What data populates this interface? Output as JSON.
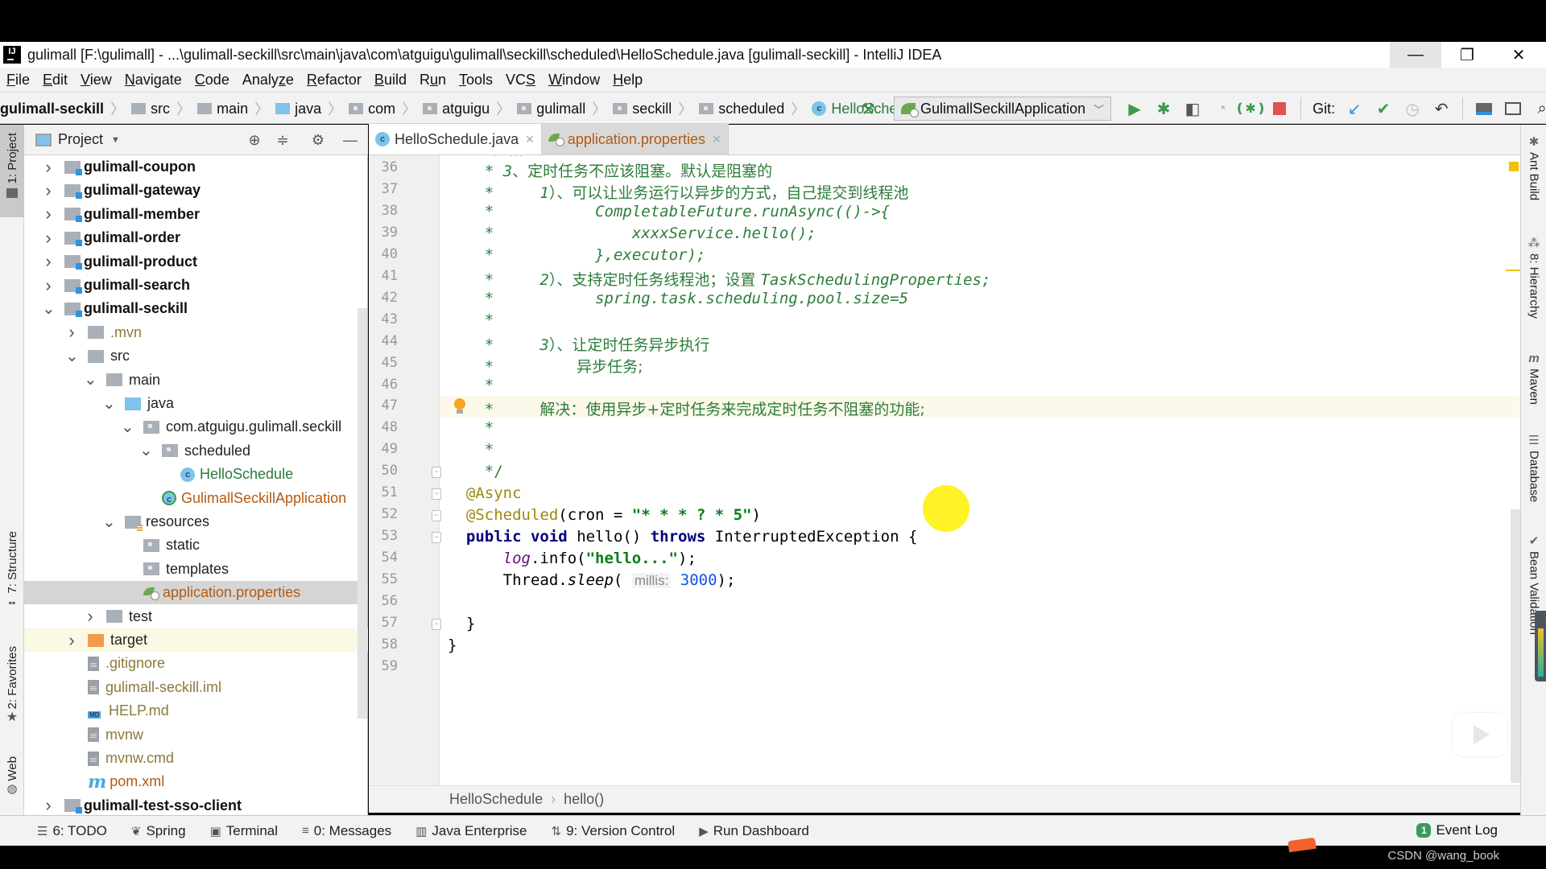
{
  "window": {
    "title": "gulimall [F:\\gulimall] - ...\\gulimall-seckill\\src\\main\\java\\com\\atguigu\\gulimall\\seckill\\scheduled\\HelloSchedule.java [gulimall-seckill] - IntelliJ IDEA",
    "logo": "IJ",
    "minimize": "—",
    "restore": "❐",
    "close": "✕"
  },
  "menu": [
    {
      "u": "F",
      "rest": "ile"
    },
    {
      "u": "E",
      "rest": "dit"
    },
    {
      "u": "V",
      "rest": "iew"
    },
    {
      "u": "N",
      "rest": "avigate"
    },
    {
      "u": "C",
      "rest": "ode"
    },
    {
      "pre": "Analy",
      "u": "z",
      "rest": "e"
    },
    {
      "u": "R",
      "rest": "efactor"
    },
    {
      "u": "B",
      "rest": "uild"
    },
    {
      "pre": "R",
      "u": "u",
      "rest": "n"
    },
    {
      "u": "T",
      "rest": "ools"
    },
    {
      "pre": "VC",
      "u": "S",
      "rest": ""
    },
    {
      "u": "W",
      "rest": "indow"
    },
    {
      "u": "H",
      "rest": "elp"
    }
  ],
  "navbar": {
    "crumbs": [
      "gulimall-seckill",
      "src",
      "main",
      "java",
      "com",
      "atguigu",
      "gulimall",
      "seckill",
      "scheduled",
      "HelloSchedule"
    ],
    "run_config": "GulimallSeckillApplication",
    "git_label": "Git:",
    "icons": {
      "build": "hammer-icon",
      "run": "run-icon",
      "debug": "debug-icon",
      "coverage": "coverage-icon",
      "profile": "profile-icon",
      "attach_debugger": "attach-debugger-icon",
      "stop": "stop-icon",
      "git_update": "git-update-icon",
      "git_commit": "git-commit-icon",
      "git_history": "git-history-icon",
      "git_rollback": "git-rollback-icon",
      "project_structure": "project-structure-icon",
      "run_anything": "run-anything-icon",
      "search": "search-icon"
    }
  },
  "left_strip": {
    "project": "1: Project",
    "structure": "7: Structure",
    "favorites": "2: Favorites",
    "web": "Web"
  },
  "project_panel": {
    "title": "Project",
    "tree": [
      {
        "label": "gulimall-coupon",
        "level": 0,
        "arrow": "collapsed",
        "icon": "module",
        "style": "bold"
      },
      {
        "label": "gulimall-gateway",
        "level": 0,
        "arrow": "collapsed",
        "icon": "module",
        "style": "bold"
      },
      {
        "label": "gulimall-member",
        "level": 0,
        "arrow": "collapsed",
        "icon": "module",
        "style": "bold"
      },
      {
        "label": "gulimall-order",
        "level": 0,
        "arrow": "collapsed",
        "icon": "module",
        "style": "bold"
      },
      {
        "label": "gulimall-product",
        "level": 0,
        "arrow": "collapsed",
        "icon": "module",
        "style": "bold"
      },
      {
        "label": "gulimall-search",
        "level": 0,
        "arrow": "collapsed",
        "icon": "module",
        "style": "bold"
      },
      {
        "label": "gulimall-seckill",
        "level": 0,
        "arrow": "expanded",
        "icon": "module",
        "style": "bold"
      },
      {
        "label": ".mvn",
        "level": 1,
        "arrow": "collapsed",
        "icon": "folder",
        "style": "olive"
      },
      {
        "label": "src",
        "level": 1,
        "arrow": "expanded",
        "icon": "folder",
        "style": "dark"
      },
      {
        "label": "main",
        "level": 2,
        "arrow": "expanded",
        "icon": "folder",
        "style": "dark"
      },
      {
        "label": "java",
        "level": 3,
        "arrow": "expanded",
        "icon": "source-folder",
        "style": "dark"
      },
      {
        "label": "com.atguigu.gulimall.seckill",
        "level": 4,
        "arrow": "expanded",
        "icon": "package",
        "style": "dark"
      },
      {
        "label": "scheduled",
        "level": 5,
        "arrow": "expanded",
        "icon": "package",
        "style": "dark"
      },
      {
        "label": "HelloSchedule",
        "level": 6,
        "arrow": "none",
        "icon": "class",
        "style": "green"
      },
      {
        "label": "GulimallSeckillApplication",
        "level": 5,
        "arrow": "none",
        "icon": "spring-boot-class",
        "style": "orange"
      },
      {
        "label": "resources",
        "level": 3,
        "arrow": "expanded",
        "icon": "resources-folder",
        "style": "dark"
      },
      {
        "label": "static",
        "level": 4,
        "arrow": "none",
        "icon": "package",
        "style": "dark"
      },
      {
        "label": "templates",
        "level": 4,
        "arrow": "none",
        "icon": "package",
        "style": "dark"
      },
      {
        "label": "application.properties",
        "level": 4,
        "arrow": "none",
        "icon": "spring-properties",
        "style": "orange",
        "selected": true
      },
      {
        "label": "test",
        "level": 2,
        "arrow": "collapsed",
        "icon": "folder",
        "style": "dark"
      },
      {
        "label": "target",
        "level": 1,
        "arrow": "collapsed",
        "icon": "excluded-folder",
        "style": "dark",
        "excluded": true
      },
      {
        "label": ".gitignore",
        "level": 1,
        "arrow": "none",
        "icon": "text-file",
        "style": "olive"
      },
      {
        "label": "gulimall-seckill.iml",
        "level": 1,
        "arrow": "none",
        "icon": "iml-file",
        "style": "olive"
      },
      {
        "label": "HELP.md",
        "level": 1,
        "arrow": "none",
        "icon": "markdown-file",
        "style": "olive"
      },
      {
        "label": "mvnw",
        "level": 1,
        "arrow": "none",
        "icon": "text-file",
        "style": "olive"
      },
      {
        "label": "mvnw.cmd",
        "level": 1,
        "arrow": "none",
        "icon": "text-file",
        "style": "olive"
      },
      {
        "label": "pom.xml",
        "level": 1,
        "arrow": "none",
        "icon": "maven-file",
        "style": "orange"
      },
      {
        "label": "gulimall-test-sso-client",
        "level": 0,
        "arrow": "collapsed",
        "icon": "module",
        "style": "bold"
      }
    ]
  },
  "editor": {
    "tabs": [
      {
        "label": "HelloSchedule.java",
        "active": true,
        "icon": "class-icon"
      },
      {
        "label": "application.properties",
        "active": false,
        "icon": "spring-properties-icon"
      }
    ],
    "lines": [
      {
        "n": 36,
        "text": "         * 3、定时任务不应该阻塞。默认是阻塞的"
      },
      {
        "n": 37,
        "text": "         *      1）、可以让业务运行以异步的方式，自己提交到线程池"
      },
      {
        "n": 38,
        "text": "         *              CompletableFuture.runAsync(()->{"
      },
      {
        "n": 39,
        "text": "         *                  xxxxService.hello();"
      },
      {
        "n": 40,
        "text": "         *              },executor);"
      },
      {
        "n": 41,
        "text": "         *      2）、支持定时任务线程池；设置 TaskSchedulingProperties;"
      },
      {
        "n": 42,
        "text": "         *              spring.task.scheduling.pool.size=5"
      },
      {
        "n": 43,
        "text": "         *"
      },
      {
        "n": 44,
        "text": "         *      3）、让定时任务异步执行"
      },
      {
        "n": 45,
        "text": "         *          异步任务;"
      },
      {
        "n": 46,
        "text": "         *"
      },
      {
        "n": 47,
        "text": "         *     解决：使用异步+定时任务来完成定时任务不阻塞的功能;"
      },
      {
        "n": 48,
        "text": "         *"
      },
      {
        "n": 49,
        "text": "         *"
      },
      {
        "n": 50,
        "text": "         */"
      },
      {
        "n": 51,
        "text": "    @Async"
      },
      {
        "n": 52,
        "text": "    @Scheduled(cron = \"* * * ? * 5\")"
      },
      {
        "n": 53,
        "text": "    public void hello() throws InterruptedException {"
      },
      {
        "n": 54,
        "text": "        log.info(\"hello...\");"
      },
      {
        "n": 55,
        "text": "        Thread.sleep( millis: 3000);"
      },
      {
        "n": 56,
        "text": ""
      },
      {
        "n": 57,
        "text": "    }"
      },
      {
        "n": 58,
        "text": "}"
      },
      {
        "n": 59,
        "text": ""
      }
    ],
    "current_line": 47,
    "parts": {
      "l36_star": "* ",
      "l36_num": "3",
      "l36_cn": "、定时任务不应该阻塞。默认是阻塞的",
      "star": "*",
      "l37_num": "1",
      "l37_cn": "）、可以让业务运行以异步的方式，自己提交到线程池",
      "l38_code": "CompletableFuture.runAsync(()->{",
      "l39_code": "xxxxService.hello();",
      "l40_code": "},executor);",
      "l41_num": "2",
      "l41_cn": "）、支持定时任务线程池；设置 ",
      "l41_code": "TaskSchedulingProperties;",
      "l42_code": "spring.task.scheduling.pool.size=5",
      "l44_num": "3",
      "l44_cn": "）、让定时任务异步执行",
      "l45_cn": "异步任务;",
      "l47_cn": "解决：使用异步+定时任务来完成定时任务不阻塞的功能;",
      "l50_code": "*/",
      "l51_anno": "@Async",
      "l52_anno": "@Scheduled",
      "l52_rest": "(cron = ",
      "l52_str": "\"* * * ? * 5\"",
      "l52_end": ")",
      "l53_kw1": "public",
      "l53_kw2": "void",
      "l53_name": " hello() ",
      "l53_kw3": "throws",
      "l53_rest": " InterruptedException {",
      "l54_static": "log",
      "l54_rest": ".info(",
      "l54_str": "\"hello...\"",
      "l54_end": ");",
      "l55_a": "Thread.",
      "l55_m": "sleep",
      "l55_b": "( ",
      "l55_hint": "millis:",
      "l55_num": "3000",
      "l55_end": ");",
      "l57": "}",
      "l58": "}"
    },
    "breadcrumb": [
      "HelloSchedule",
      "hello()"
    ]
  },
  "right_strip": [
    "Ant Build",
    "8: Hierarchy",
    "Maven",
    "Database",
    "Bean Validation"
  ],
  "bottom_bar": {
    "tabs": [
      {
        "label": "6: TODO",
        "icon": "todo-icon"
      },
      {
        "label": "Spring",
        "icon": "spring-icon"
      },
      {
        "label": "Terminal",
        "icon": "terminal-icon"
      },
      {
        "label": "0: Messages",
        "icon": "messages-icon"
      },
      {
        "label": "Java Enterprise",
        "icon": "java-enterprise-icon"
      },
      {
        "label": "9: Version Control",
        "icon": "version-control-icon"
      },
      {
        "label": "Run Dashboard",
        "icon": "run-dashboard-icon"
      }
    ],
    "event_log": {
      "label": "Event Log",
      "count": "1"
    }
  },
  "watermark": "CSDN @wang_book"
}
